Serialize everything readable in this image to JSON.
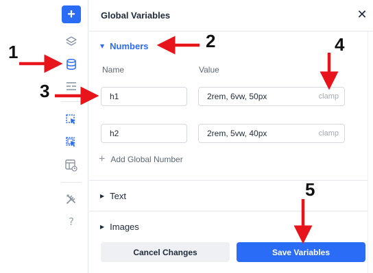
{
  "sidebar": {
    "add_icon": "plus-icon",
    "icons": [
      "layers-icon",
      "database-icon",
      "template-icon",
      "cursor-select-icon",
      "cursor-select-alt-icon",
      "page-settings-icon",
      "tools-icon",
      "help-icon"
    ],
    "add_glyph": "+",
    "help_glyph": "?",
    "accent": "#2b6cf6"
  },
  "panel": {
    "title": "Global Variables",
    "close_glyph": "✕",
    "numbers_section": {
      "label": "Numbers",
      "expanded": true,
      "columns": {
        "name": "Name",
        "value": "Value"
      },
      "variables": [
        {
          "name": "h1",
          "value": "2rem, 6vw, 50px",
          "unit": "clamp"
        },
        {
          "name": "h2",
          "value": "2rem, 5vw, 40px",
          "unit": "clamp"
        }
      ],
      "add_label": "Add Global Number",
      "add_glyph": "+"
    },
    "text_section": {
      "label": "Text",
      "expanded": false
    },
    "images_section": {
      "label": "Images",
      "expanded": false
    },
    "caret_down": "▼",
    "caret_right": "▶",
    "cancel_label": "Cancel Changes",
    "save_label": "Save Variables"
  },
  "annotations": {
    "one": "1",
    "two": "2",
    "three": "3",
    "four": "4",
    "five": "5",
    "arrow_color": "#e8141b"
  }
}
